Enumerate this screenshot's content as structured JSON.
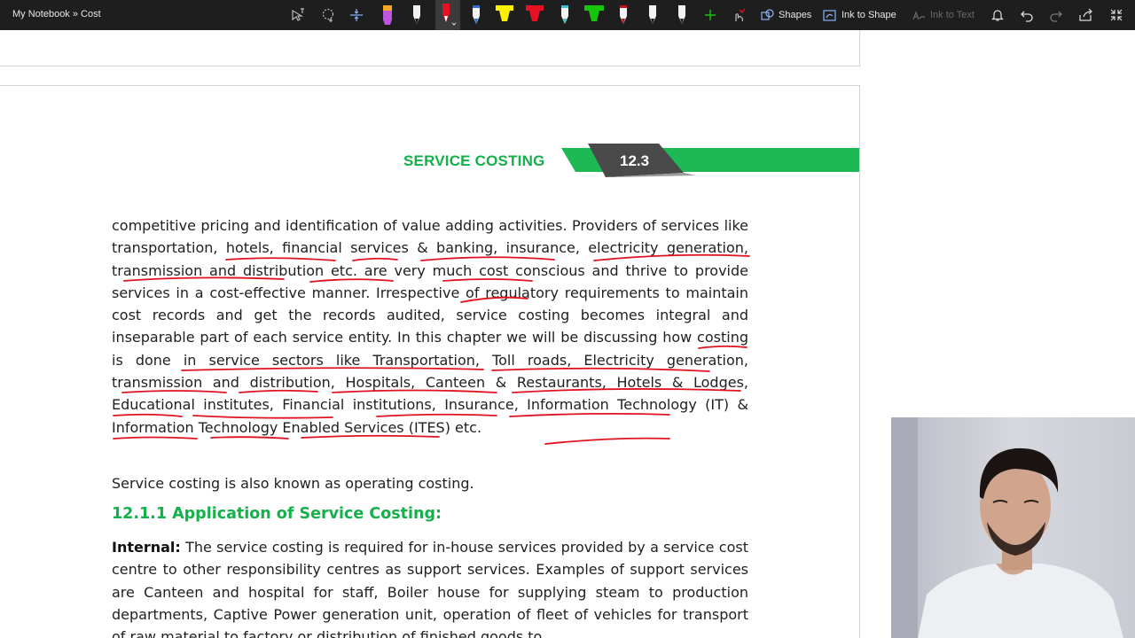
{
  "titlebar": {
    "title": "My Notebook » Cost"
  },
  "toolbar": {
    "lasso_select": "lasso-select-icon",
    "lasso_add": "lasso-add-icon",
    "add_space": "add-space-icon",
    "pens": [
      {
        "name": "purple-highlighter",
        "color": "#b56ad6"
      },
      {
        "name": "black-pen",
        "color": "#111111"
      },
      {
        "name": "red-pen",
        "color": "#e81123",
        "selected": true
      },
      {
        "name": "blue-pen",
        "color": "#2f6fd1"
      },
      {
        "name": "yellow-highlighter",
        "color": "#fff100"
      },
      {
        "name": "red-highlighter",
        "color": "#e81123"
      },
      {
        "name": "cyan-pen",
        "color": "#35c2d1"
      },
      {
        "name": "green-highlighter",
        "color": "#16c60c"
      },
      {
        "name": "dark-red-pen",
        "color": "#c50f1f"
      },
      {
        "name": "black-pen-2",
        "color": "#222222"
      },
      {
        "name": "black-pen-3",
        "color": "#222222"
      }
    ],
    "shapes_label": "Shapes",
    "ink_to_shape_label": "Ink to Shape",
    "ink_to_text_label": "Ink to Text"
  },
  "page": {
    "section_title": "SERVICE COSTING",
    "section_number": "12.3",
    "para1": "competitive pricing and identification of value adding activities.  Providers of services like transportation, hotels, financial services & banking, insurance, electricity generation, transmission and distribution etc. are very much cost conscious and thrive to provide services in a cost-effective manner. Irrespective of regulatory requirements to maintain cost records and get the records audited, service costing becomes integral and inseparable part of each service entity. In this chapter we will be discussing how costing is done in service sectors like Transportation, Toll roads, Electricity generation, transmission and distribution, Hospitals, Canteen & Restaurants, Hotels & Lodges, Educational institutes, Financial institutions, Insurance, Information Technology (IT) & Information Technology Enabled Services (ITES) etc.",
    "para2": "Service costing is also known as operating costing.",
    "subheading": "12.1.1 Application of Service Costing:",
    "para3_label": "Internal:",
    "para3": " The service costing is required for in-house services provided by a service cost centre to other responsibility centres as support services. Examples of support services are Canteen and hospital for staff, Boiler house for supplying steam to production departments, Captive Power generation unit, operation of fleet of vehicles for transport of raw material to factory or distribution of finished goods to"
  },
  "colors": {
    "accent_green": "#14b04a",
    "banner_green": "#1db954",
    "banner_dark": "#4a4a4a",
    "ink_red": "#e0121f",
    "toolbar_bg": "#1e1e1e"
  }
}
